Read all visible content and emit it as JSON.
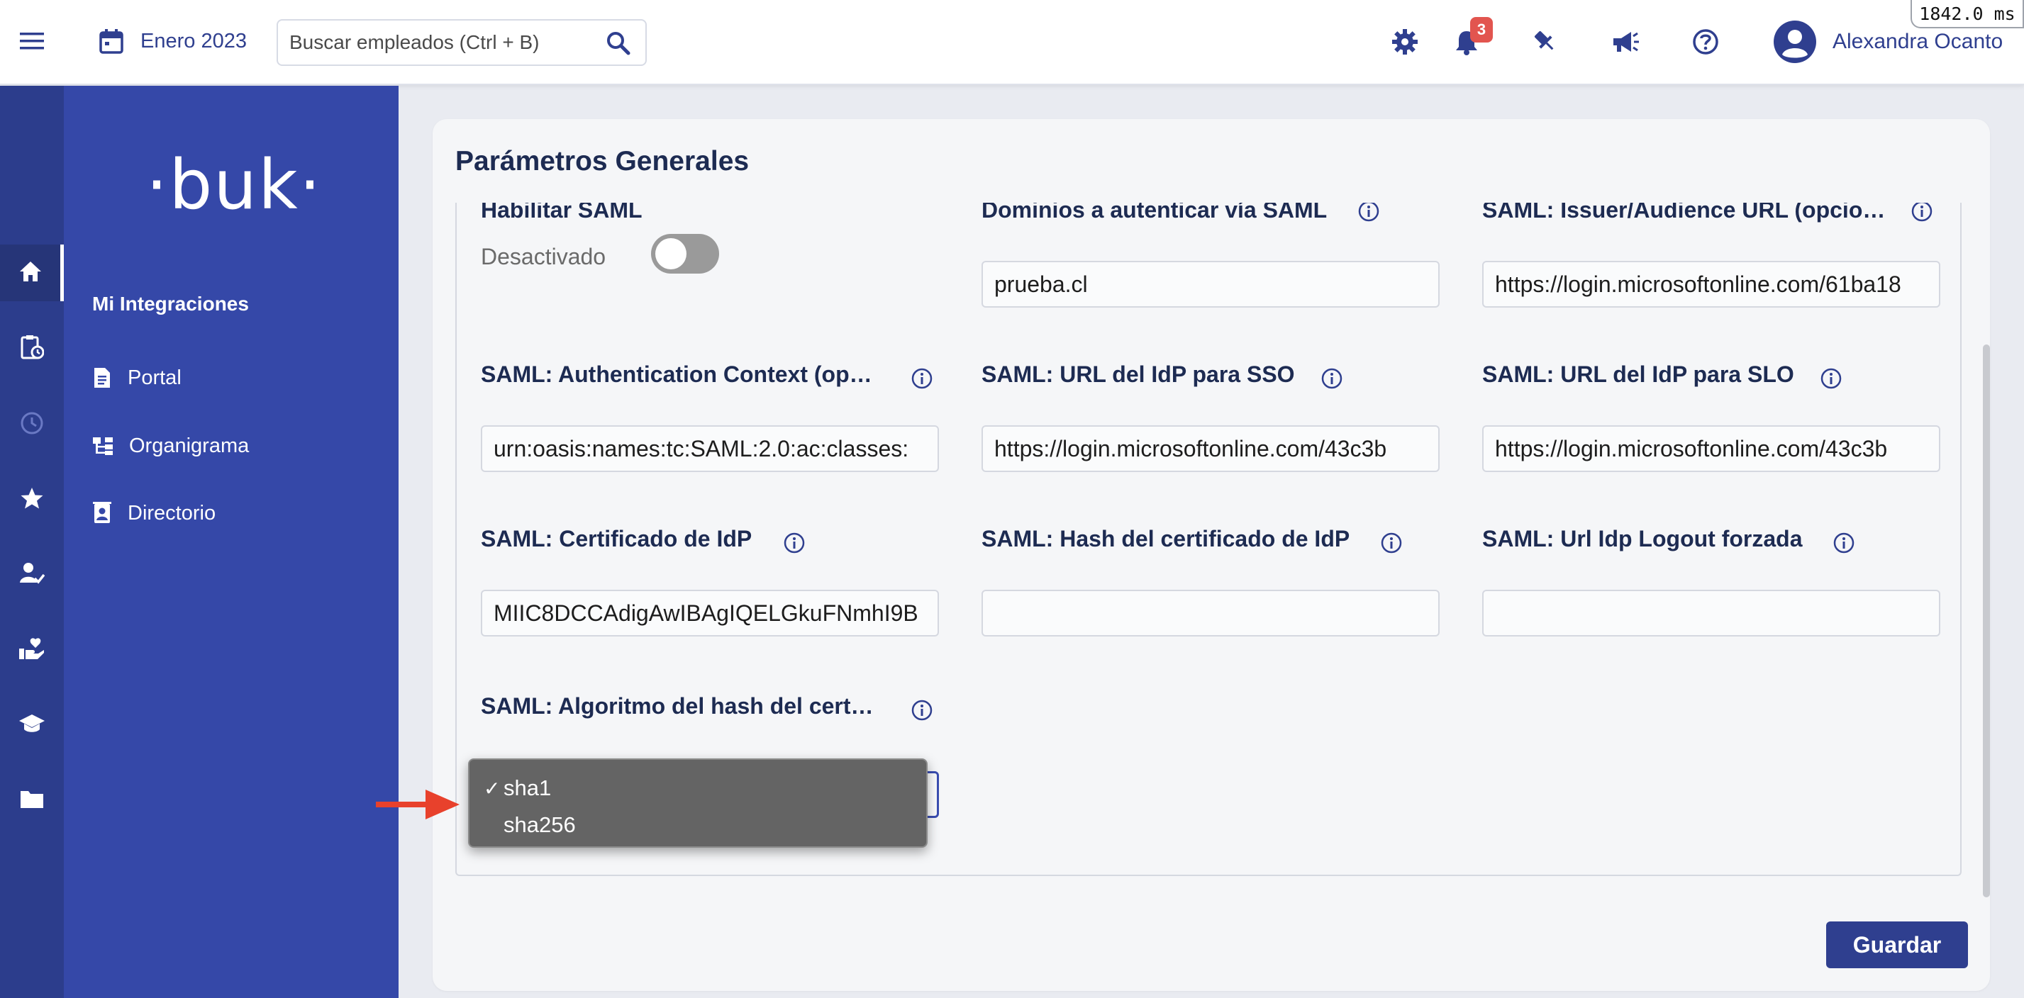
{
  "topbar": {
    "period_label": "Enero 2023",
    "search_placeholder": "Buscar empleados (Ctrl + B)",
    "notification_count": "3",
    "user_name": "Alexandra Ocanto",
    "timing_readout": "1842.0 ms"
  },
  "sidebar": {
    "logo_text": "·buk·",
    "section_title": "Mi Integraciones",
    "items": [
      {
        "label": "Portal",
        "icon": "document-icon"
      },
      {
        "label": "Organigrama",
        "icon": "org-chart-icon"
      },
      {
        "label": "Directorio",
        "icon": "contact-book-icon"
      }
    ]
  },
  "rail": {
    "items": [
      "home-icon",
      "clipboard-clock-icon",
      "clock-icon",
      "star-icon",
      "user-check-icon",
      "hand-heart-icon",
      "graduation-cap-icon",
      "folder-icon"
    ],
    "active": "home-icon"
  },
  "main": {
    "title": "Parámetros Generales",
    "fields": {
      "enable_saml": {
        "label": "Habilitar SAML",
        "state_text": "Desactivado",
        "enabled": false
      },
      "domains": {
        "label": "Dominios a autenticar vía SAML",
        "value": "prueba.cl"
      },
      "issuer": {
        "label": "SAML: Issuer/Audience URL (opcio…",
        "value": "https://login.microsoftonline.com/61ba18"
      },
      "auth_context": {
        "label": "SAML: Authentication Context (op…",
        "value": "urn:oasis:names:tc:SAML:2.0:ac:classes:"
      },
      "sso_url": {
        "label": "SAML: URL del IdP para SSO",
        "value": "https://login.microsoftonline.com/43c3b"
      },
      "slo_url": {
        "label": "SAML: URL del IdP para SLO",
        "value": "https://login.microsoftonline.com/43c3b"
      },
      "idp_cert": {
        "label": "SAML: Certificado de IdP",
        "value": "MIIC8DCCAdigAwIBAgIQELGkuFNmhI9B"
      },
      "cert_hash": {
        "label": "SAML: Hash del certificado de IdP",
        "value": ""
      },
      "logout_url": {
        "label": "SAML: Url Idp Logout forzada",
        "value": ""
      },
      "hash_algorithm": {
        "label": "SAML: Algoritmo del hash del cert…",
        "options": [
          "sha1",
          "sha256"
        ],
        "selected": "sha1",
        "check_mark": "✓"
      }
    },
    "save_label": "Guardar"
  },
  "colors": {
    "brand": "#2f3f8f",
    "sidebar": "#3548a8",
    "rail": "#2c3d8c",
    "badge": "#e2554f",
    "annotation_arrow": "#e8412c"
  }
}
